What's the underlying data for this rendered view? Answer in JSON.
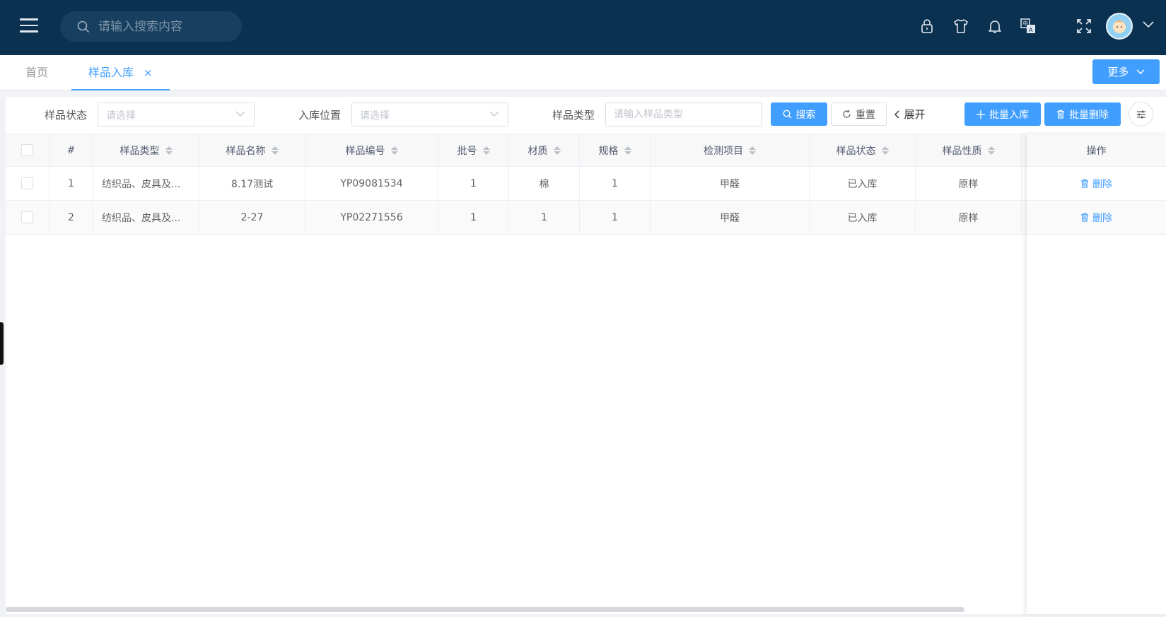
{
  "header": {
    "search_placeholder": "请输入搜索内容",
    "icons": [
      "lock-icon",
      "shirt-icon",
      "bell-icon",
      "translate-icon",
      "fullscreen-icon"
    ]
  },
  "tabs": [
    {
      "label": "首页",
      "active": false
    },
    {
      "label": "样品入库",
      "active": true,
      "close": "×"
    }
  ],
  "more_button": "更多",
  "filters": {
    "status_label": "样品状态",
    "status_placeholder": "请选择",
    "location_label": "入库位置",
    "location_placeholder": "请选择",
    "type_label": "样品类型",
    "type_placeholder": "请输入样品类型"
  },
  "buttons": {
    "search": "搜索",
    "reset": "重置",
    "expand": "展开",
    "batch_in": "批量入库",
    "batch_delete": "批量删除"
  },
  "table": {
    "columns": [
      "#",
      "样品类型",
      "样品名称",
      "样品编号",
      "批号",
      "材质",
      "规格",
      "检测项目",
      "样品状态",
      "样品性质"
    ],
    "action_header": "操作",
    "rows": [
      {
        "index": "1",
        "type": "纺织品、皮具及...",
        "name": "8.17测试",
        "code": "YP09081534",
        "batch": "1",
        "material": "棉",
        "spec": "1",
        "item": "甲醛",
        "status": "已入库",
        "nature": "原样",
        "action": "删除"
      },
      {
        "index": "2",
        "type": "纺织品、皮具及...",
        "name": "2-27",
        "code": "YP02271556",
        "batch": "1",
        "material": "1",
        "spec": "1",
        "item": "甲醛",
        "status": "已入库",
        "nature": "原样",
        "action": "删除"
      }
    ]
  },
  "colors": {
    "header_bg": "#0b3150",
    "primary": "#409eff"
  }
}
